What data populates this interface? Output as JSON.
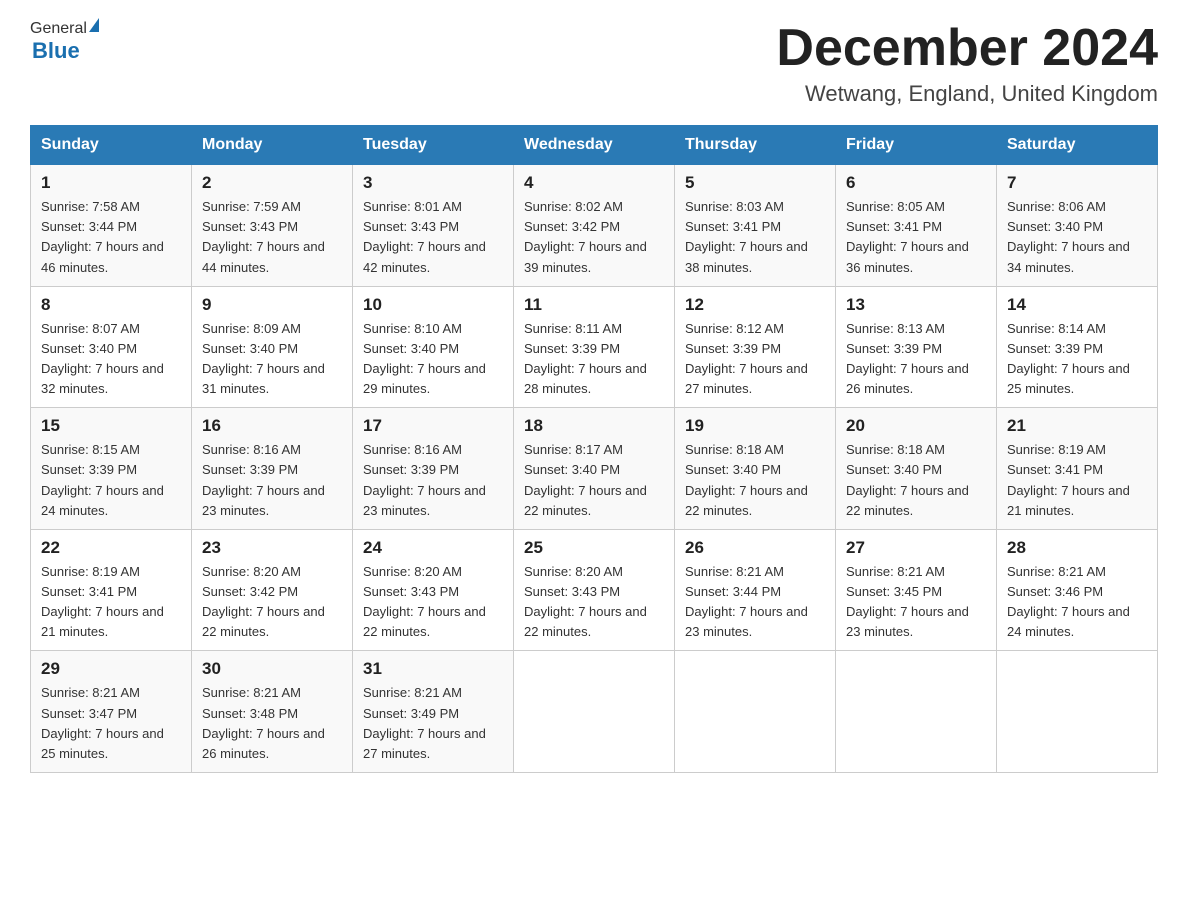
{
  "header": {
    "logo_general": "General",
    "logo_blue": "Blue",
    "title": "December 2024",
    "subtitle": "Wetwang, England, United Kingdom"
  },
  "weekdays": [
    "Sunday",
    "Monday",
    "Tuesday",
    "Wednesday",
    "Thursday",
    "Friday",
    "Saturday"
  ],
  "weeks": [
    [
      {
        "day": "1",
        "sunrise": "7:58 AM",
        "sunset": "3:44 PM",
        "daylight": "7 hours and 46 minutes."
      },
      {
        "day": "2",
        "sunrise": "7:59 AM",
        "sunset": "3:43 PM",
        "daylight": "7 hours and 44 minutes."
      },
      {
        "day": "3",
        "sunrise": "8:01 AM",
        "sunset": "3:43 PM",
        "daylight": "7 hours and 42 minutes."
      },
      {
        "day": "4",
        "sunrise": "8:02 AM",
        "sunset": "3:42 PM",
        "daylight": "7 hours and 39 minutes."
      },
      {
        "day": "5",
        "sunrise": "8:03 AM",
        "sunset": "3:41 PM",
        "daylight": "7 hours and 38 minutes."
      },
      {
        "day": "6",
        "sunrise": "8:05 AM",
        "sunset": "3:41 PM",
        "daylight": "7 hours and 36 minutes."
      },
      {
        "day": "7",
        "sunrise": "8:06 AM",
        "sunset": "3:40 PM",
        "daylight": "7 hours and 34 minutes."
      }
    ],
    [
      {
        "day": "8",
        "sunrise": "8:07 AM",
        "sunset": "3:40 PM",
        "daylight": "7 hours and 32 minutes."
      },
      {
        "day": "9",
        "sunrise": "8:09 AM",
        "sunset": "3:40 PM",
        "daylight": "7 hours and 31 minutes."
      },
      {
        "day": "10",
        "sunrise": "8:10 AM",
        "sunset": "3:40 PM",
        "daylight": "7 hours and 29 minutes."
      },
      {
        "day": "11",
        "sunrise": "8:11 AM",
        "sunset": "3:39 PM",
        "daylight": "7 hours and 28 minutes."
      },
      {
        "day": "12",
        "sunrise": "8:12 AM",
        "sunset": "3:39 PM",
        "daylight": "7 hours and 27 minutes."
      },
      {
        "day": "13",
        "sunrise": "8:13 AM",
        "sunset": "3:39 PM",
        "daylight": "7 hours and 26 minutes."
      },
      {
        "day": "14",
        "sunrise": "8:14 AM",
        "sunset": "3:39 PM",
        "daylight": "7 hours and 25 minutes."
      }
    ],
    [
      {
        "day": "15",
        "sunrise": "8:15 AM",
        "sunset": "3:39 PM",
        "daylight": "7 hours and 24 minutes."
      },
      {
        "day": "16",
        "sunrise": "8:16 AM",
        "sunset": "3:39 PM",
        "daylight": "7 hours and 23 minutes."
      },
      {
        "day": "17",
        "sunrise": "8:16 AM",
        "sunset": "3:39 PM",
        "daylight": "7 hours and 23 minutes."
      },
      {
        "day": "18",
        "sunrise": "8:17 AM",
        "sunset": "3:40 PM",
        "daylight": "7 hours and 22 minutes."
      },
      {
        "day": "19",
        "sunrise": "8:18 AM",
        "sunset": "3:40 PM",
        "daylight": "7 hours and 22 minutes."
      },
      {
        "day": "20",
        "sunrise": "8:18 AM",
        "sunset": "3:40 PM",
        "daylight": "7 hours and 22 minutes."
      },
      {
        "day": "21",
        "sunrise": "8:19 AM",
        "sunset": "3:41 PM",
        "daylight": "7 hours and 21 minutes."
      }
    ],
    [
      {
        "day": "22",
        "sunrise": "8:19 AM",
        "sunset": "3:41 PM",
        "daylight": "7 hours and 21 minutes."
      },
      {
        "day": "23",
        "sunrise": "8:20 AM",
        "sunset": "3:42 PM",
        "daylight": "7 hours and 22 minutes."
      },
      {
        "day": "24",
        "sunrise": "8:20 AM",
        "sunset": "3:43 PM",
        "daylight": "7 hours and 22 minutes."
      },
      {
        "day": "25",
        "sunrise": "8:20 AM",
        "sunset": "3:43 PM",
        "daylight": "7 hours and 22 minutes."
      },
      {
        "day": "26",
        "sunrise": "8:21 AM",
        "sunset": "3:44 PM",
        "daylight": "7 hours and 23 minutes."
      },
      {
        "day": "27",
        "sunrise": "8:21 AM",
        "sunset": "3:45 PM",
        "daylight": "7 hours and 23 minutes."
      },
      {
        "day": "28",
        "sunrise": "8:21 AM",
        "sunset": "3:46 PM",
        "daylight": "7 hours and 24 minutes."
      }
    ],
    [
      {
        "day": "29",
        "sunrise": "8:21 AM",
        "sunset": "3:47 PM",
        "daylight": "7 hours and 25 minutes."
      },
      {
        "day": "30",
        "sunrise": "8:21 AM",
        "sunset": "3:48 PM",
        "daylight": "7 hours and 26 minutes."
      },
      {
        "day": "31",
        "sunrise": "8:21 AM",
        "sunset": "3:49 PM",
        "daylight": "7 hours and 27 minutes."
      },
      null,
      null,
      null,
      null
    ]
  ]
}
